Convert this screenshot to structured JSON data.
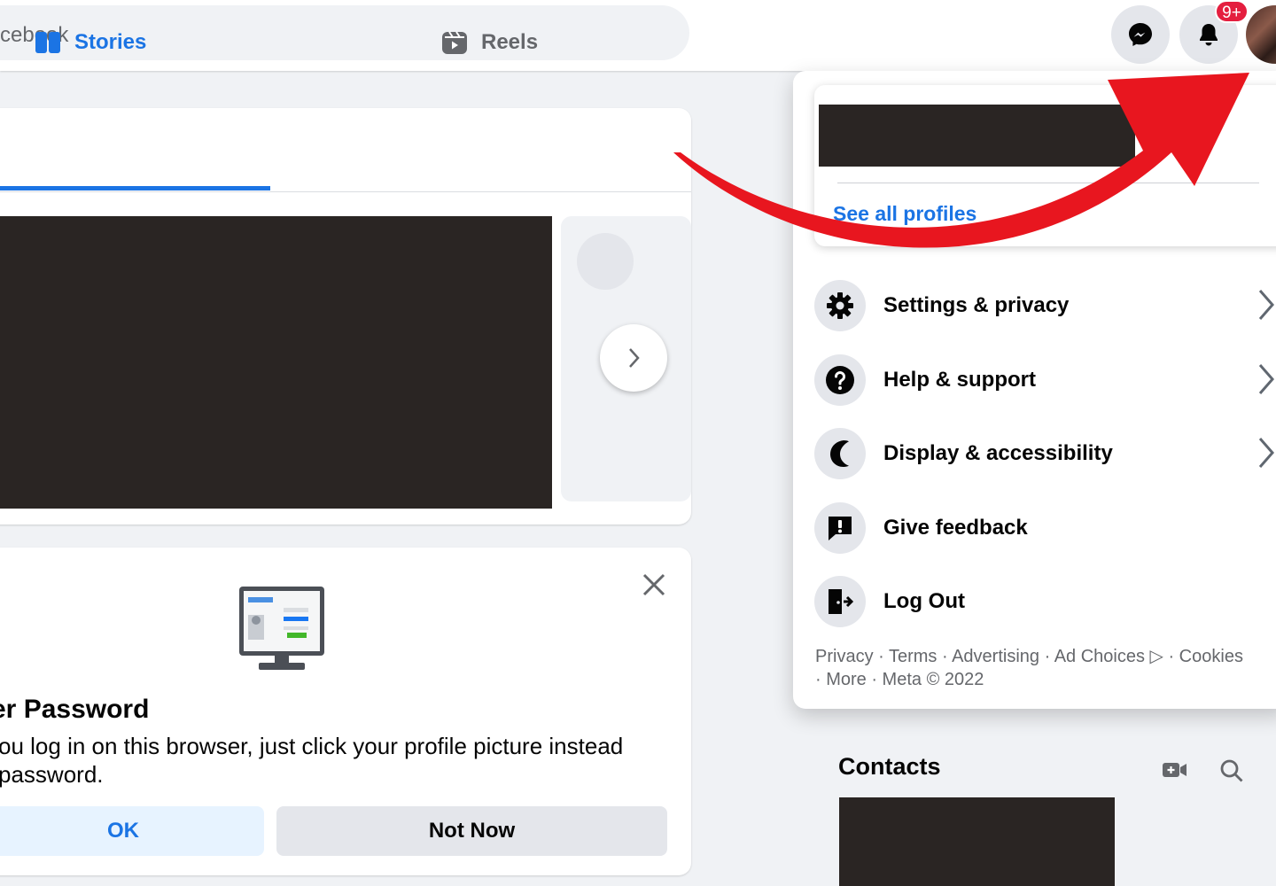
{
  "header": {
    "search_text": "cebook",
    "notifications_badge": "9+",
    "icons": [
      "messenger-icon",
      "bell-icon"
    ]
  },
  "stories": {
    "tabs": [
      {
        "label": "Stories",
        "icon": "stories-icon",
        "active": true
      },
      {
        "label": "Reels",
        "icon": "reels-icon",
        "active": false
      }
    ]
  },
  "password_prompt": {
    "title": "er Password",
    "description_line1": "ou log in on this browser, just click your profile picture instead",
    "description_line2": "password.",
    "ok_label": "OK",
    "not_now_label": "Not Now"
  },
  "account_menu": {
    "see_all_profiles": "See all profiles",
    "items": [
      {
        "label": "Settings & privacy",
        "icon": "gear-icon",
        "has_chevron": true
      },
      {
        "label": "Help & support",
        "icon": "question-icon",
        "has_chevron": true
      },
      {
        "label": "Display & accessibility",
        "icon": "moon-icon",
        "has_chevron": true
      },
      {
        "label": "Give feedback",
        "icon": "feedback-icon",
        "has_chevron": false
      },
      {
        "label": "Log Out",
        "icon": "logout-icon",
        "has_chevron": false
      }
    ],
    "footer_line1": "Privacy · Terms · Advertising · Ad Choices ▷ · Cookies",
    "footer_line2": "· More · Meta © 2022"
  },
  "contacts": {
    "title": "Contacts"
  },
  "colors": {
    "accent": "#1b74e4",
    "badge": "#e41e3f",
    "annotation_arrow": "#e8161f"
  }
}
